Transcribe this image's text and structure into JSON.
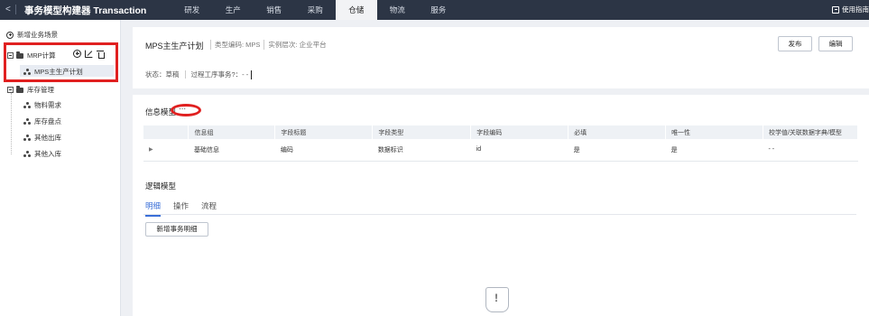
{
  "app": {
    "back_glyph": "<",
    "title": "事务模型构建器 Transaction"
  },
  "nav": {
    "items": [
      "研发",
      "生产",
      "销售",
      "采购",
      "仓储",
      "物流",
      "服务"
    ],
    "active": "仓储"
  },
  "guide": {
    "label": "使用指南",
    "icon": "guide-icon"
  },
  "sidebar": {
    "add_label": "新增业务场景",
    "tree": [
      {
        "label": "MRP计算",
        "children": [
          "MPS主生产计划"
        ]
      },
      {
        "label": "库存管理",
        "children": [
          "物料需求",
          "库存盘点",
          "其他出库",
          "其他入库"
        ]
      }
    ],
    "selected": "MPS主生产计划"
  },
  "header": {
    "title": "MPS主生产计划",
    "type_code": "类型编码: MPS",
    "instance_level": "实例层次: 企业平台",
    "status": "状态：草稿",
    "process_flag": "过程工序事务?：- -",
    "publish_label": "发布",
    "edit_label": "编辑"
  },
  "info_model": {
    "title": "信息模型",
    "ellipsis_glyph": "⋯",
    "columns": [
      "信息组",
      "字段标题",
      "字段类型",
      "字段编码",
      "必填",
      "唯一性",
      "校学值/关联数据字典/模型"
    ],
    "rows": [
      {
        "group": "基础信息",
        "field_title": "编码",
        "field_type": "数据标识",
        "field_code": "id",
        "required": "是",
        "unique": "是",
        "dict": "- -"
      }
    ]
  },
  "logic_model": {
    "title": "逻辑模型",
    "tabs": [
      "明细",
      "操作",
      "流程"
    ],
    "active_tab": "明细",
    "add_detail_label": "新增事务明细"
  },
  "colors": {
    "topbar": "#2c3545",
    "accent": "#3a6fd8",
    "highlight": "#e02020"
  }
}
